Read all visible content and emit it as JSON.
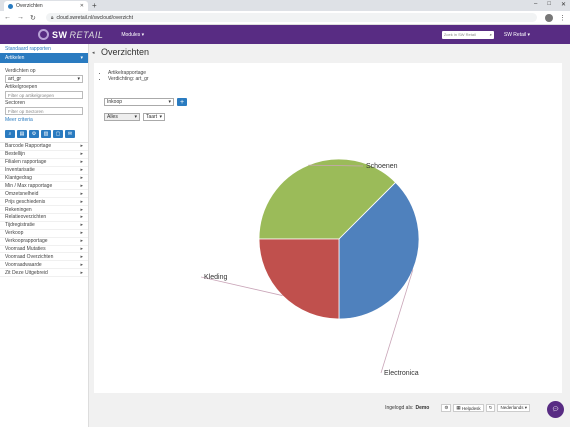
{
  "browser": {
    "tab_title": "Overzichten",
    "url": "cloud.swretail.nl/swcloud/overzicht",
    "controls": [
      "–",
      "□",
      "✕"
    ]
  },
  "topnav": {
    "logo_sw": "SW",
    "logo_retail": "RETAIL",
    "modules_label": "Modules ▾",
    "search_placeholder": "Zoek in SW Retail",
    "account_label": "SW Retail ▾"
  },
  "sidebar": {
    "standard_reports": "Standaard rapporten",
    "active_section": "Artikelen",
    "filter_label": "Verdichten op",
    "filter_value": "art_gr",
    "group_label": "Artikelgroepen",
    "group_placeholder": "Filter op artikelgroepen",
    "sector_label": "Sectoren",
    "sector_placeholder": "Filter op Sectoren",
    "more_criteria": "Meer criteria",
    "menu": [
      "Barcode Rapportage",
      "Bestellijn",
      "Filialen rapportage",
      "Inventarisatie",
      "Klantgedrag",
      "Min / Max rapportage",
      "Omzetsnelheid",
      "Prijs geschiedenis",
      "Rekeningen",
      "Relatieoverzichten",
      "Tijdregistratie",
      "Verkoop",
      "Verkooprapportage",
      "Voorraad Mutaties",
      "Voorraad Overzichten",
      "Voorraadwaarde",
      "Zit Deze Uitgebreid"
    ]
  },
  "main": {
    "page_title": "Overzichten",
    "criteria": [
      "Artikelrapportage",
      "Verdichting: art_gr"
    ],
    "measure_select": "Inkoop",
    "period_select": "Alles",
    "chart_type_select": "Taart"
  },
  "chart_data": {
    "type": "pie",
    "title": "",
    "slices": [
      {
        "label": "Schoenen",
        "value": 37.5,
        "color": "#9bbb59"
      },
      {
        "label": "Electronica",
        "value": 37.5,
        "color": "#4f81bd"
      },
      {
        "label": "Kleding",
        "value": 25.0,
        "color": "#c0504d"
      }
    ]
  },
  "footer": {
    "logged_in_label": "Ingelogd als:",
    "logged_in_user": "Demo",
    "help_label": "Helpdesk",
    "language": "Nederlands ▾"
  }
}
